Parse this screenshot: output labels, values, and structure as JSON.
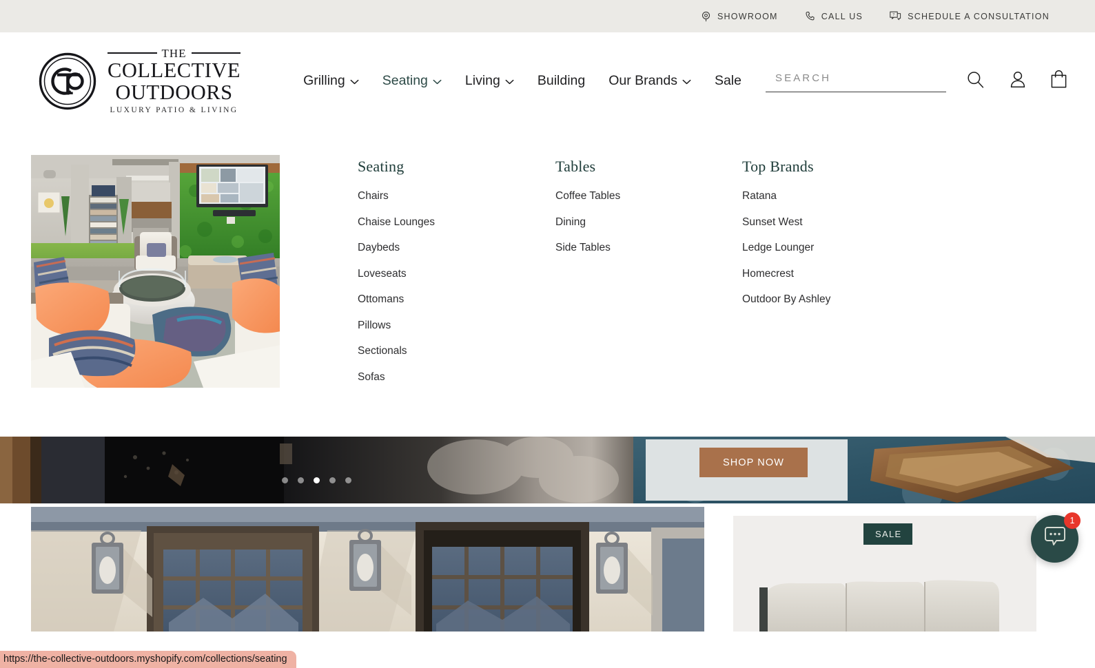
{
  "topbar": {
    "links": [
      {
        "label": "SHOWROOM",
        "icon": "location-pin-icon"
      },
      {
        "label": "CALL US",
        "icon": "phone-icon"
      },
      {
        "label": "SCHEDULE A CONSULTATION",
        "icon": "chat-question-icon"
      }
    ]
  },
  "logo": {
    "monogram": "CTO",
    "the": "THE",
    "line1": "COLLECTIVE",
    "line2": "OUTDOORS",
    "tagline": "LUXURY PATIO & LIVING"
  },
  "nav": {
    "items": [
      {
        "label": "Grilling",
        "has_caret": true,
        "active": false
      },
      {
        "label": "Seating",
        "has_caret": true,
        "active": true
      },
      {
        "label": "Living",
        "has_caret": true,
        "active": false
      },
      {
        "label": "Building",
        "has_caret": false,
        "active": false
      },
      {
        "label": "Our Brands",
        "has_caret": true,
        "active": false
      },
      {
        "label": "Sale",
        "has_caret": false,
        "active": false
      }
    ],
    "active_color": "#2d4a47"
  },
  "search": {
    "placeholder": "SEARCH",
    "value": ""
  },
  "header_icons": [
    {
      "name": "search-icon"
    },
    {
      "name": "account-icon"
    },
    {
      "name": "cart-bag-icon"
    }
  ],
  "megamenu": {
    "open_for": "Seating",
    "feature_image_alt": "Outdoor showroom with sectional sofa, round fire pit table and green wall",
    "columns": [
      {
        "title": "Seating",
        "links": [
          "Chairs",
          "Chaise Lounges",
          "Daybeds",
          "Loveseats",
          "Ottomans",
          "Pillows",
          "Sectionals",
          "Sofas"
        ]
      },
      {
        "title": "Tables",
        "links": [
          "Coffee Tables",
          "Dining",
          "Side Tables"
        ]
      },
      {
        "title": "Top Brands",
        "links": [
          "Ratana",
          "Sunset West",
          "Ledge Lounger",
          "Homecrest",
          "Outdoor By Ashley"
        ]
      }
    ]
  },
  "carousel": {
    "dots": 5,
    "active_dot": 3,
    "shop_button": "SHOP NOW",
    "button_color": "#a9714b"
  },
  "lower": {
    "promo_image_alt": "Building facade with large windows and wall lanterns",
    "product": {
      "badge": "SALE",
      "badge_color": "#22433f",
      "image_alt": "Beige outdoor sofa with three cushions"
    }
  },
  "chat": {
    "icon": "chat-bubble-icon",
    "unread": "1",
    "bubble_color": "#2a4a47",
    "badge_color": "#e8362b"
  },
  "status_bar": {
    "url": "https://the-collective-outdoors.myshopify.com/collections/seating"
  }
}
